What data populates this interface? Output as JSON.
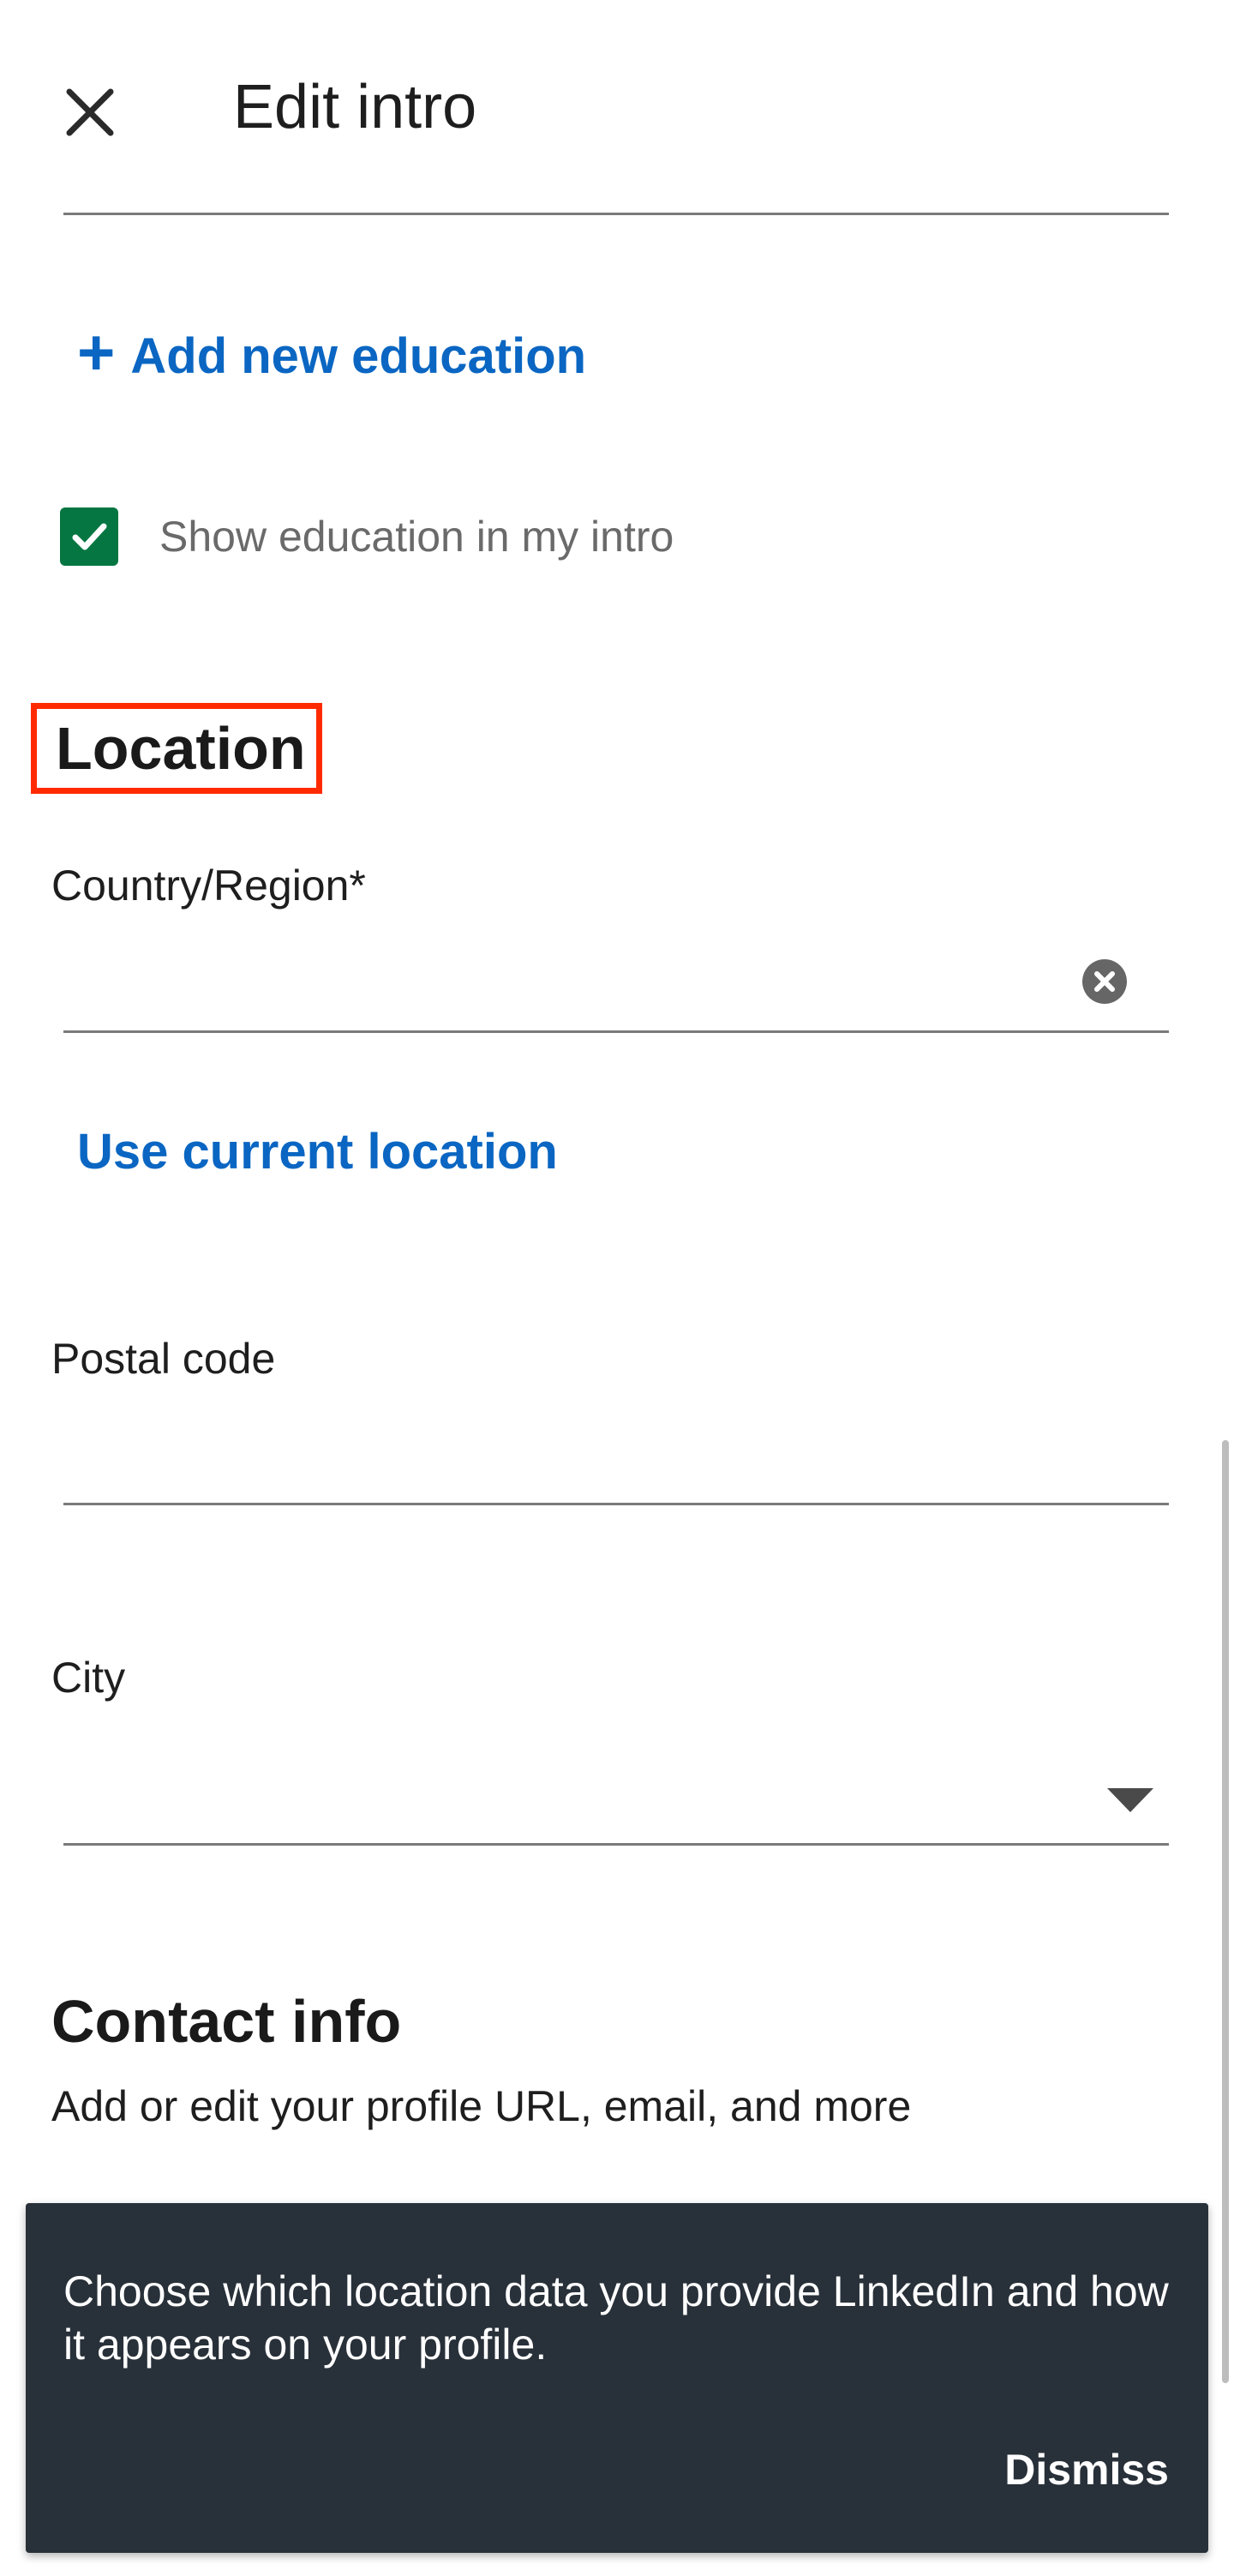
{
  "header": {
    "title": "Edit intro",
    "close_icon": "close-icon"
  },
  "education": {
    "add_link": "Add new education",
    "add_icon": "plus-icon",
    "show_checkbox_label": "Show education in my intro",
    "show_checked": true
  },
  "location": {
    "heading": "Location",
    "country_label": "Country/Region*",
    "country_value": "",
    "clear_icon": "clear-circle-icon",
    "use_current_link": "Use current location",
    "postal_label": "Postal code",
    "postal_value": "",
    "city_label": "City",
    "city_value": "",
    "city_dropdown_icon": "caret-down-icon"
  },
  "contact": {
    "heading": "Contact info",
    "subtitle": "Add or edit your profile URL, email, and more"
  },
  "toast": {
    "message": "Choose which location data you provide LinkedIn and how it appears on your profile.",
    "dismiss_label": "Dismiss"
  },
  "colors": {
    "link": "#0a66c2",
    "checkbox": "#057642",
    "highlight_box": "#ff2a00",
    "toast_bg": "#283039"
  }
}
